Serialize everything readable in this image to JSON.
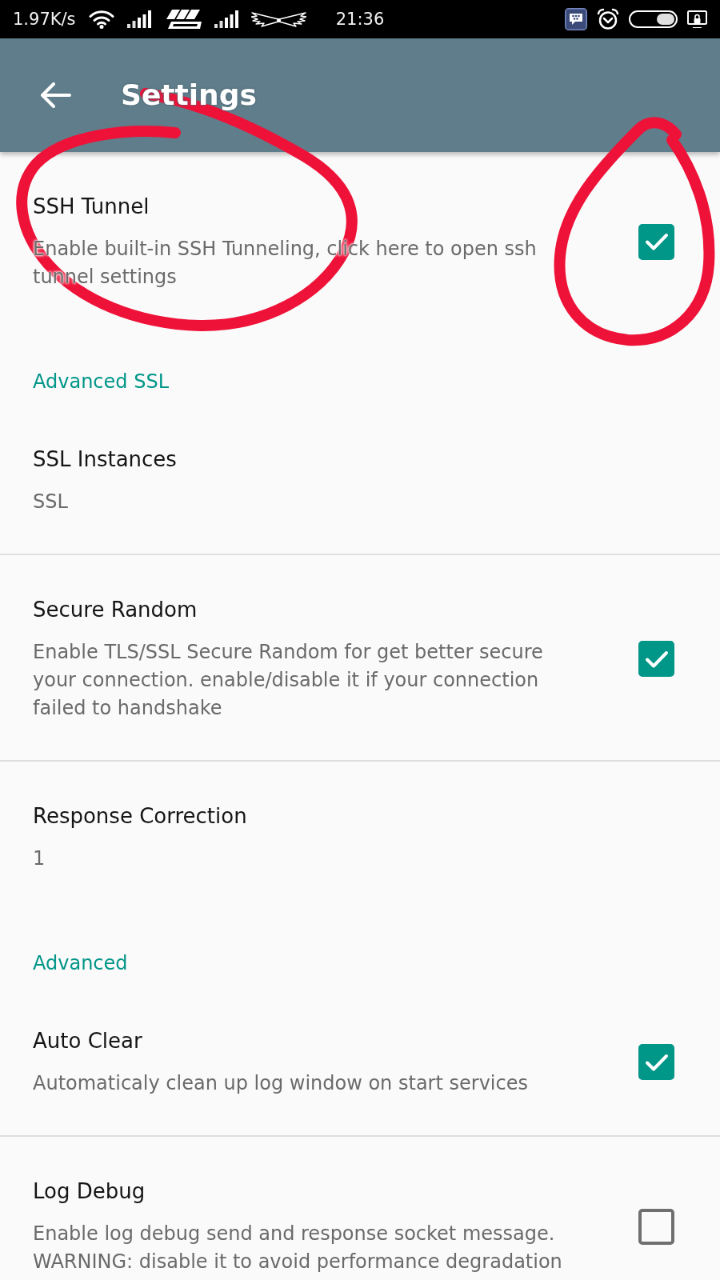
{
  "status_bar": {
    "network_speed": "1.97K/s",
    "time": "21:36"
  },
  "app_bar": {
    "title": "Settings"
  },
  "preferences": [
    {
      "kind": "checkbox",
      "title": "SSH Tunnel",
      "summary": "Enable built-in SSH Tunneling, click here to open ssh tunnel settings",
      "checked": true
    },
    {
      "kind": "category",
      "title": "Advanced SSL"
    },
    {
      "kind": "text",
      "title": "SSL Instances",
      "summary": "SSL"
    },
    {
      "kind": "checkbox",
      "title": "Secure Random",
      "summary": "Enable TLS/SSL Secure Random for get better secure your connection. enable/disable it if your connection failed to handshake",
      "checked": true
    },
    {
      "kind": "text",
      "title": "Response Correction",
      "summary": "1"
    },
    {
      "kind": "category",
      "title": "Advanced"
    },
    {
      "kind": "checkbox",
      "title": "Auto Clear",
      "summary": "Automaticaly clean up log window on start services",
      "checked": true
    },
    {
      "kind": "checkbox",
      "title": "Log Debug",
      "summary": "Enable log debug send and response socket message. WARNING: disable it to avoid performance degradation",
      "checked": false
    }
  ]
}
